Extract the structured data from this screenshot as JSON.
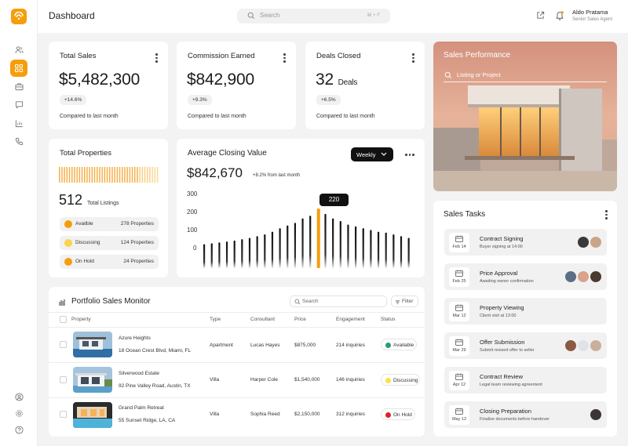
{
  "header": {
    "title": "Dashboard",
    "search_placeholder": "Search",
    "search_shortcut": "⌘ + F",
    "user_name": "Aldo Pratama",
    "user_role": "Senior Sales Agent"
  },
  "stats": [
    {
      "title": "Total Sales",
      "value": "$5,482,300",
      "change": "+14.6%",
      "footnote": "Compared to last month"
    },
    {
      "title": "Commission Earned",
      "value": "$842,900",
      "change": "+9.3%",
      "footnote": "Compared to last month"
    },
    {
      "title": "Deals Closed",
      "value": "32",
      "suffix": "Deals",
      "change": "+6.5%",
      "footnote": "Compared to last month"
    }
  ],
  "properties": {
    "title": "Total Properties",
    "total": "512",
    "total_label": "Total Listings",
    "rows": [
      {
        "label": "Availble",
        "value": "278 Properties",
        "color": "#f59e0b"
      },
      {
        "label": "Discussing",
        "value": "124 Properties",
        "color": "#fcd34d"
      },
      {
        "label": "On Hold",
        "value": "24 Properties",
        "color": "#f59e0b"
      }
    ]
  },
  "closing": {
    "title": "Average Closing Value",
    "value": "$842,670",
    "change": "+8.2% from last month",
    "period": "Weekly",
    "tooltip": "220",
    "yticks": [
      "300",
      "200",
      "100",
      "0"
    ]
  },
  "chart_data": {
    "type": "bar",
    "title": "Average Closing Value",
    "ylim": [
      0,
      300
    ],
    "highlight_index": 15,
    "values": [
      20,
      25,
      30,
      35,
      40,
      48,
      55,
      65,
      75,
      90,
      110,
      125,
      140,
      165,
      180,
      220,
      190,
      165,
      150,
      130,
      120,
      110,
      100,
      90,
      85,
      75,
      65,
      55
    ]
  },
  "performance": {
    "title": "Sales Performance",
    "search_placeholder": "Listing or Project"
  },
  "portfolio": {
    "title": "Portfolio Sales Monitor",
    "search_placeholder": "Search",
    "filter_label": "Filter",
    "columns": [
      "Property",
      "Type",
      "Consultant",
      "Price",
      "Engagement",
      "Status"
    ],
    "rows": [
      {
        "name": "Azure Heights",
        "address": "18 Ocean Crest Blvd, Miami, FL",
        "type": "Apartment",
        "consultant": "Lucas Hayes",
        "price": "$875,000",
        "engagement": "214 inquiries",
        "status": "Available",
        "status_color": "#22a06b"
      },
      {
        "name": "Silverwood Estate",
        "address": "92 Pine Valley Road, Austin, TX",
        "type": "Villa",
        "consultant": "Harper Cole",
        "price": "$1,540,000",
        "engagement": "146 inquiries",
        "status": "Discussing",
        "status_color": "#fde047"
      },
      {
        "name": "Grand Palm Retreat",
        "address": "55 Sunset Ridge, LA, CA",
        "type": "Villa",
        "consultant": "Sophia Reed",
        "price": "$2,150,000",
        "engagement": "312 inquiries",
        "status": "On Hold",
        "status_color": "#e11d2e"
      }
    ]
  },
  "tasks": {
    "title": "Sales Tasks",
    "items": [
      {
        "date": "Feb 14",
        "title": "Contract Signing",
        "subtitle": "Buyer signing at 14:00"
      },
      {
        "date": "Feb 25",
        "title": "Price Approval",
        "subtitle": "Awaiting owner confirmation"
      },
      {
        "date": "Mar 12",
        "title": "Property Viewing",
        "subtitle": "Client visit at 13:00"
      },
      {
        "date": "Mar 29",
        "title": "Offer Submission",
        "subtitle": "Submit revised offer to seller"
      },
      {
        "date": "Apr 12",
        "title": "Contract Review",
        "subtitle": "Legal team reviewing agreement"
      },
      {
        "date": "May 12",
        "title": "Closing Preparation",
        "subtitle": "Finalize documents before handover"
      }
    ]
  },
  "colors": {
    "accent": "#f59e0b",
    "dark": "#1e1e1e"
  }
}
